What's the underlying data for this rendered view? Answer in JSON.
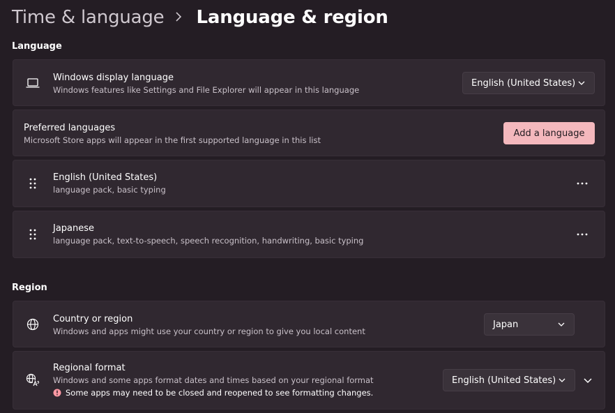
{
  "breadcrumb": {
    "parent": "Time & language",
    "current": "Language & region"
  },
  "language_section": {
    "title": "Language",
    "display_language": {
      "icon": "laptop-icon",
      "title": "Windows display language",
      "subtitle": "Windows features like Settings and File Explorer will appear in this language",
      "value": "English (United States)"
    },
    "preferred": {
      "title": "Preferred languages",
      "subtitle": "Microsoft Store apps will appear in the first supported language in this list",
      "button_label": "Add a language"
    },
    "languages": [
      {
        "name": "English (United States)",
        "features": "language pack, basic typing"
      },
      {
        "name": "Japanese",
        "features": "language pack, text-to-speech, speech recognition, handwriting, basic typing"
      }
    ]
  },
  "region_section": {
    "title": "Region",
    "country": {
      "icon": "globe-icon",
      "title": "Country or region",
      "subtitle": "Windows and apps might use your country or region to give you local content",
      "value": "Japan"
    },
    "format": {
      "icon": "regional-format-icon",
      "title": "Regional format",
      "subtitle": "Windows and some apps format dates and times based on your regional format",
      "warning": "Some apps may need to be closed and reopened to see formatting changes.",
      "value": "English (United States)"
    }
  },
  "colors": {
    "background": "#241d24",
    "card": "#302830",
    "accent": "#f4b8bd",
    "warning": "#ff99a4"
  }
}
